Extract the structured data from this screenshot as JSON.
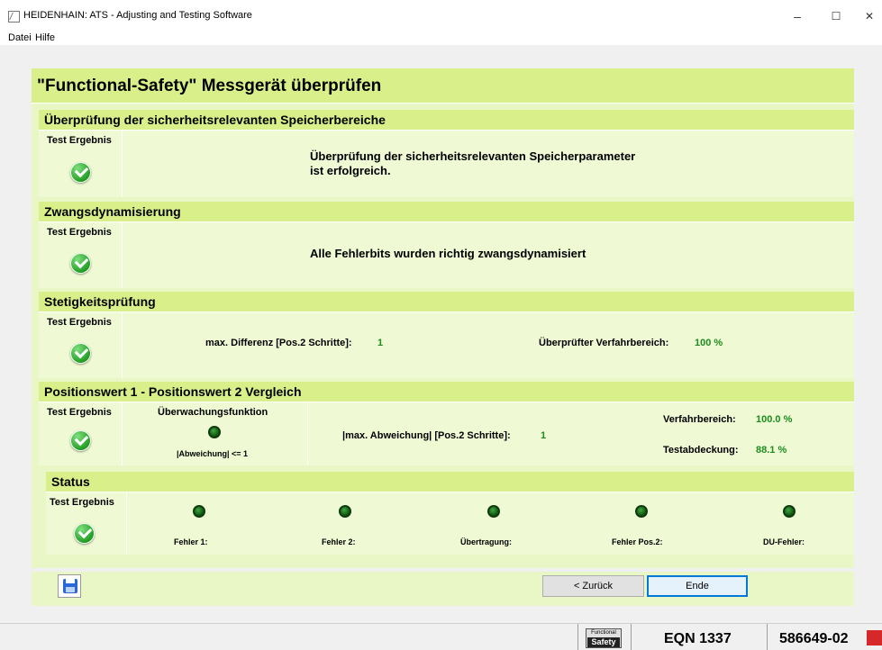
{
  "window": {
    "title": "HEIDENHAIN: ATS - Adjusting and Testing Software",
    "minimize": "–",
    "maximize": "☐",
    "close": "✕"
  },
  "menu": [
    "Datei",
    "Hilfe"
  ],
  "main_title": "\"Functional-Safety\" Messgerät überprüfen",
  "test_result_label": "Test Ergebnis",
  "sections": {
    "memory": {
      "title": "Überprüfung der sicherheitsrelevanten Speicherbereiche",
      "message_line1": "Überprüfung der sicherheitsrelevanten Speicherparameter",
      "message_line2": "ist erfolgreich."
    },
    "dynamization": {
      "title": "Zwangsdynamisierung",
      "message": "Alle Fehlerbits wurden richtig zwangsdynamisiert"
    },
    "continuity": {
      "title": "Stetigkeitsprüfung",
      "max_diff_label": "max. Differenz [Pos.2 Schritte]:",
      "max_diff_value": "1",
      "range_label": "Überprüfter Verfahrbereich:",
      "range_value": "100 %"
    },
    "comparison": {
      "title": "Positionswert 1 - Positionswert 2 Vergleich",
      "monitoring_label": "Überwachungsfunktion",
      "deviation_condition": "|Abweichung| <= 1",
      "max_dev_label": "|max. Abweichung| [Pos.2 Schritte]:",
      "max_dev_value": "1",
      "travel_label": "Verfahrbereich:",
      "travel_value": "100.0 %",
      "coverage_label": "Testabdeckung:",
      "coverage_value": "88.1 %"
    },
    "status": {
      "title": "Status",
      "indicators": [
        "Fehler 1:",
        "Fehler 2:",
        "Übertragung:",
        "Fehler Pos.2:",
        "DU-Fehler:"
      ]
    }
  },
  "buttons": {
    "back": "< Zurück",
    "end": "Ende"
  },
  "statusbar": {
    "logo_top": "Functional",
    "logo_bottom": "Safety",
    "device": "EQN 1337",
    "serial": "586649-02"
  },
  "colors": {
    "header_green": "#d9f08a",
    "panel_green": "#eff9d4",
    "value_green": "#1e8c1e"
  }
}
